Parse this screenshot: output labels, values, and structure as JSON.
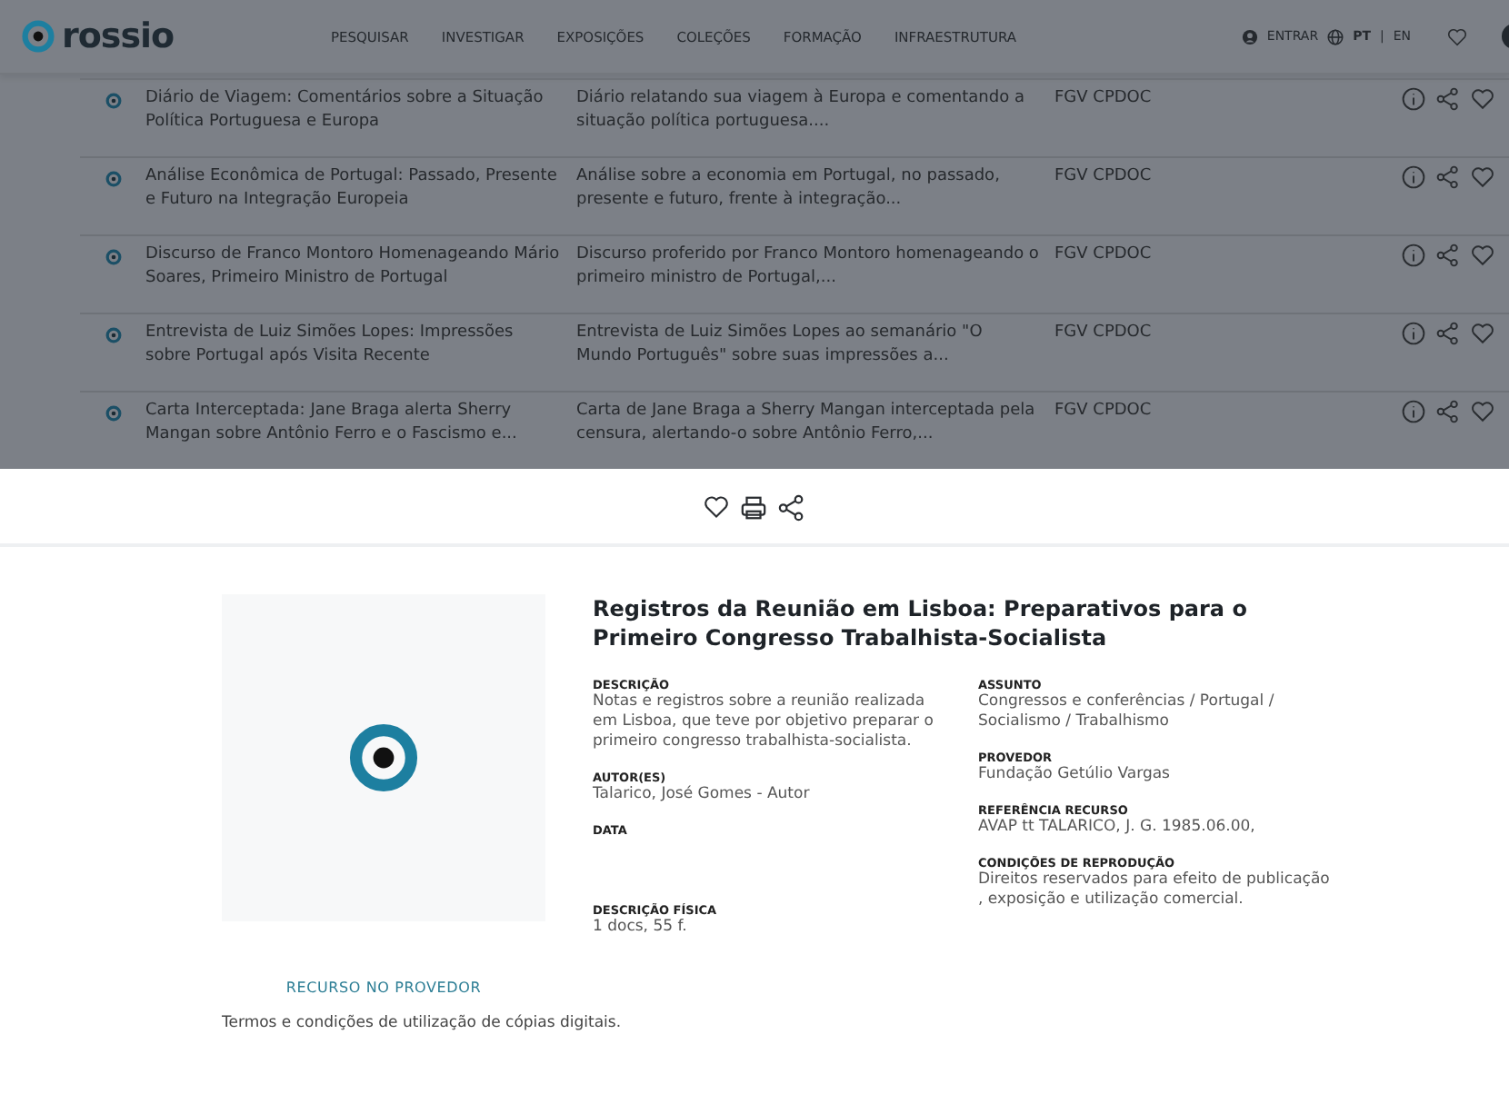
{
  "header": {
    "logo": "rossio",
    "nav": [
      "PESQUISAR",
      "INVESTIGAR",
      "EXPOSIÇÕES",
      "COLEÇÕES",
      "FORMAÇÃO",
      "INFRAESTRUTURA"
    ],
    "login": "ENTRAR",
    "languages": [
      {
        "label": "PT",
        "selected": true
      },
      {
        "label": "EN",
        "selected": false
      }
    ],
    "separator": "|"
  },
  "results": [
    {
      "title": "Diário de Viagem: Comentários sobre a Situação Política Portuguesa e Europa",
      "description": "Diário relatando sua viagem à Europa e comentando a situação política portuguesa....",
      "provider": "FGV CPDOC"
    },
    {
      "title": "Análise Econômica de Portugal: Passado, Presente e Futuro na Integração Europeia",
      "description": "Análise sobre a economia em Portugal, no passado, presente e futuro, frente à integração...",
      "provider": "FGV CPDOC"
    },
    {
      "title": "Discurso de Franco Montoro Homenageando Mário Soares, Primeiro Ministro de Portugal",
      "description": "Discurso proferido por Franco Montoro homenageando o primeiro ministro de Portugal,...",
      "provider": "FGV CPDOC"
    },
    {
      "title": "Entrevista de Luiz Simões Lopes: Impressões sobre Portugal após Visita Recente",
      "description": "Entrevista de Luiz Simões Lopes ao semanário \"O Mundo Português\" sobre suas impressões a...",
      "provider": "FGV CPDOC"
    },
    {
      "title": "Carta Interceptada: Jane Braga alerta Sherry Mangan sobre Antônio Ferro e o Fascismo e...",
      "description": "Carta de Jane Braga a Sherry Mangan interceptada pela censura, alertando-o sobre Antônio Ferro,...",
      "provider": "FGV CPDOC"
    }
  ],
  "detail": {
    "title": "Registros da Reunião em Lisboa: Preparativos para o Primeiro Congresso Trabalhista-Socialista",
    "resource_link": "RECURSO NO PROVEDOR",
    "left_fields": [
      {
        "label": "DESCRIÇÃO",
        "value": "Notas e registros sobre a reunião realizada em Lisboa, que teve por objetivo preparar o primeiro congresso trabalhista-socialista."
      },
      {
        "label": "AUTOR(ES)",
        "value": "Talarico, José Gomes - Autor"
      },
      {
        "label": "DATA"
      },
      {
        "label": "DESCRIÇÃO FÍSICA",
        "value": "1 docs, 55 f."
      }
    ],
    "right_fields": [
      {
        "label": "ASSUNTO",
        "value": "Congressos e conferências / Portugal / Socialismo / Trabalhismo"
      },
      {
        "label": "PROVEDOR",
        "value": "Fundação Getúlio Vargas"
      },
      {
        "label": "REFERÊNCIA RECURSO",
        "value": "AVAP tt TALARICO, J. G. 1985.06.00,"
      },
      {
        "label": "CONDIÇÕES DE REPRODUÇÃO",
        "value": "Direitos reservados para efeito de publicação , exposição e utilização comercial."
      }
    ],
    "terms": "Termos e condições de utilização de cópias digitais."
  }
}
